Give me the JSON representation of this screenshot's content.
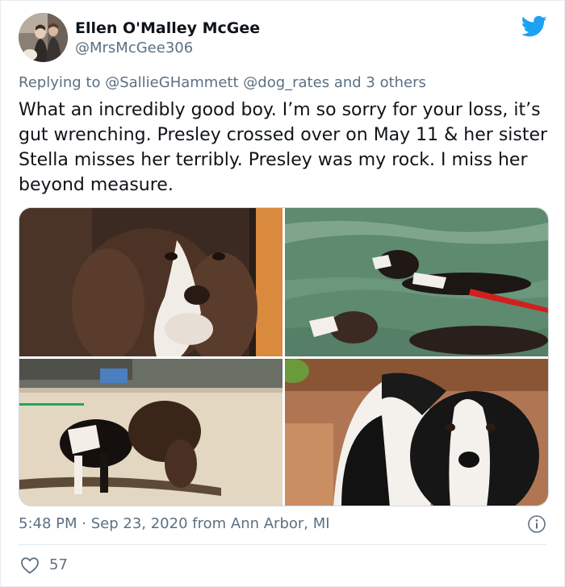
{
  "author": {
    "name": "Ellen O'Malley McGee",
    "handle": "@MrsMcGee306"
  },
  "reply": {
    "prefix": "Replying to",
    "mention_1": "@SallieGHammett",
    "mention_2": "@dog_rates",
    "suffix": "and 3 others"
  },
  "tweet": {
    "text": "What an incredibly good boy. I’m so sorry for your loss, it’s gut wrenching. Presley crossed over on May 11 & her sister Stella misses her terribly. Presley was my rock. I miss her beyond measure."
  },
  "meta": {
    "time": "5:48 PM",
    "separator": "·",
    "date": "Sep 23, 2020",
    "location_text": "from Ann Arbor, MI"
  },
  "stats": {
    "likes": "57"
  },
  "icons": {
    "brand": "twitter-bird-icon",
    "info": "info-icon",
    "like": "heart-icon"
  },
  "colors": {
    "brand": "#1da1f2",
    "secondary_text": "#5b7083",
    "primary_text": "#0f1419"
  }
}
